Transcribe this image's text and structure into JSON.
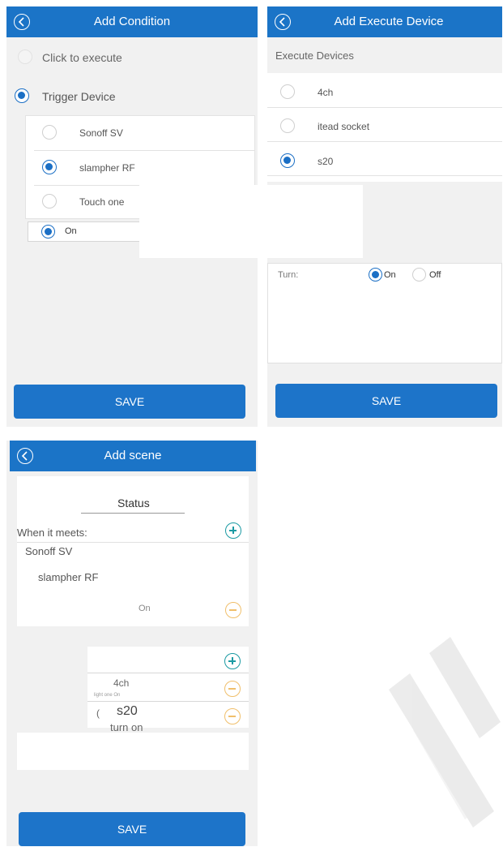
{
  "add_condition": {
    "title": "Add Condition",
    "option_click": "Click to execute",
    "option_trigger": "Trigger Device",
    "devices": [
      "Sonoff SV",
      "slampher RF",
      "Touch one"
    ],
    "state": "On",
    "save_label": "SAVE"
  },
  "add_execute": {
    "title": "Add Execute Device",
    "section_label": "Execute Devices",
    "devices": [
      "4ch",
      "itead socket",
      "s20"
    ],
    "turn_label": "Turn:",
    "on_label": "On",
    "off_label": "Off",
    "save_label": "SAVE"
  },
  "add_scene": {
    "title": "Add scene",
    "status_label": "Status",
    "when_label": "When it meets:",
    "trigger_device": "Sonoff SV",
    "trigger_subdevice": "slampher RF",
    "trigger_state": "On",
    "exec_1_name": "4ch",
    "exec_1_detail": "light one On",
    "exec_2_prefix": "(",
    "exec_2_name": "s20",
    "exec_2_detail": "turn on",
    "save_label": "SAVE"
  },
  "colors": {
    "accent": "#1b74c7",
    "plus": "#1a9aa3",
    "minus": "#f0bf6b"
  },
  "icons": [
    "back-arrow-icon",
    "radio-icon",
    "plus-circle-icon",
    "minus-circle-icon"
  ]
}
